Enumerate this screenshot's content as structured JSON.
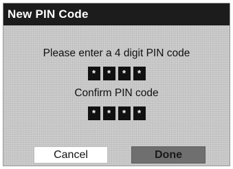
{
  "dialog": {
    "title": "New PIN Code",
    "enter_prompt": "Please enter a 4 digit PIN code",
    "confirm_prompt": "Confirm PIN code",
    "pin_entry": [
      "*",
      "*",
      "*",
      "*"
    ],
    "pin_confirm": [
      "*",
      "*",
      "*",
      "*"
    ],
    "cancel_label": "Cancel",
    "done_label": "Done"
  },
  "colors": {
    "title_bar": "#1c1c1c",
    "dialog_bg": "#c9c9c9",
    "pin_box": "#111111",
    "done_button": "#6f6f6f",
    "cancel_button": "#ffffff"
  }
}
